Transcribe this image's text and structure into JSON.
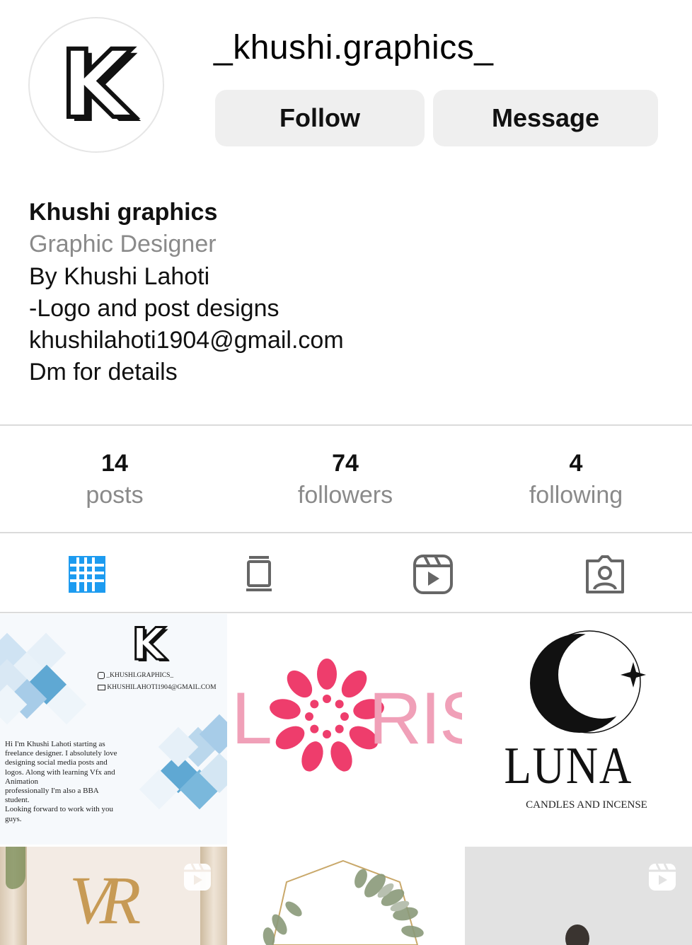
{
  "profile": {
    "username": "_khushi.graphics_",
    "avatar_letter": "K",
    "follow_label": "Follow",
    "message_label": "Message",
    "name": "Khushi graphics",
    "category": "Graphic Designer",
    "bio_lines": [
      "By Khushi Lahoti",
      "-Logo and post designs",
      "khushilahoti1904@gmail.com",
      "Dm for details"
    ]
  },
  "stats": [
    {
      "count": "14",
      "label": "posts"
    },
    {
      "count": "74",
      "label": "followers"
    },
    {
      "count": "4",
      "label": "following"
    }
  ],
  "tabs": [
    {
      "icon": "grid-icon",
      "active": true
    },
    {
      "icon": "feed-icon",
      "active": false
    },
    {
      "icon": "reels-icon",
      "active": false
    },
    {
      "icon": "tagged-icon",
      "active": false
    }
  ],
  "posts": {
    "intro": {
      "letter": "K",
      "handle": "_KHUSHI.GRAPHICS_",
      "email": "KHUSHILAHOTI1904@GMAIL.COM",
      "text_lines": [
        "Hi I'm Khushi Lahoti starting as",
        "freelance designer. I absolutely love",
        "designing social media posts and",
        "logos. Along with learning Vfx and",
        "Animation",
        "professionally I'm also a BBA",
        "student.",
        "Looking forward to work with you",
        "guys."
      ]
    },
    "loris": {
      "left": "L",
      "right": "RIS"
    },
    "luna": {
      "title": "LUNA",
      "subtitle": "CANDLES AND INCENSE"
    },
    "vr": {
      "letters": "VR"
    }
  },
  "colors": {
    "accent": "#1d9bf0",
    "icon_gray": "#666666",
    "loris_pink": "#ee3d6c"
  }
}
